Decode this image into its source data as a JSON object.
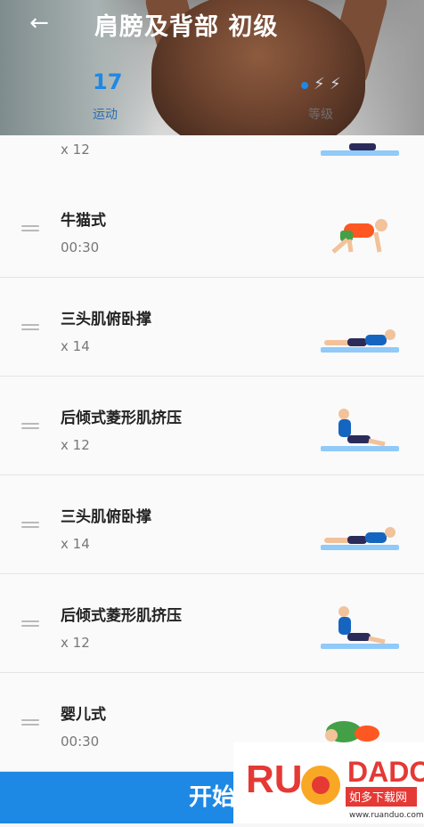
{
  "header": {
    "title": "肩膀及背部 初级",
    "stats": {
      "count": "17",
      "count_label": "运动",
      "level_label": "等级"
    },
    "back_icon": "arrow-left-icon",
    "bolt_icon": "⚡"
  },
  "exercises": [
    {
      "name": "",
      "detail": "x 12"
    },
    {
      "name": "牛猫式",
      "detail": "00:30"
    },
    {
      "name": "三头肌俯卧撑",
      "detail": "x 14"
    },
    {
      "name": "后倾式菱形肌挤压",
      "detail": "x 12"
    },
    {
      "name": "三头肌俯卧撑",
      "detail": "x 14"
    },
    {
      "name": "后倾式菱形肌挤压",
      "detail": "x 12"
    },
    {
      "name": "婴儿式",
      "detail": "00:30"
    }
  ],
  "start_button": "开始",
  "watermark": {
    "brand": "RUANDADO",
    "site": "如多下载网",
    "url": "www.ruanduo.com"
  },
  "colors": {
    "accent": "#1e88e5",
    "mat": "#90caf9",
    "shirt_green": "#4caf50",
    "shirt_orange": "#ff5722"
  }
}
